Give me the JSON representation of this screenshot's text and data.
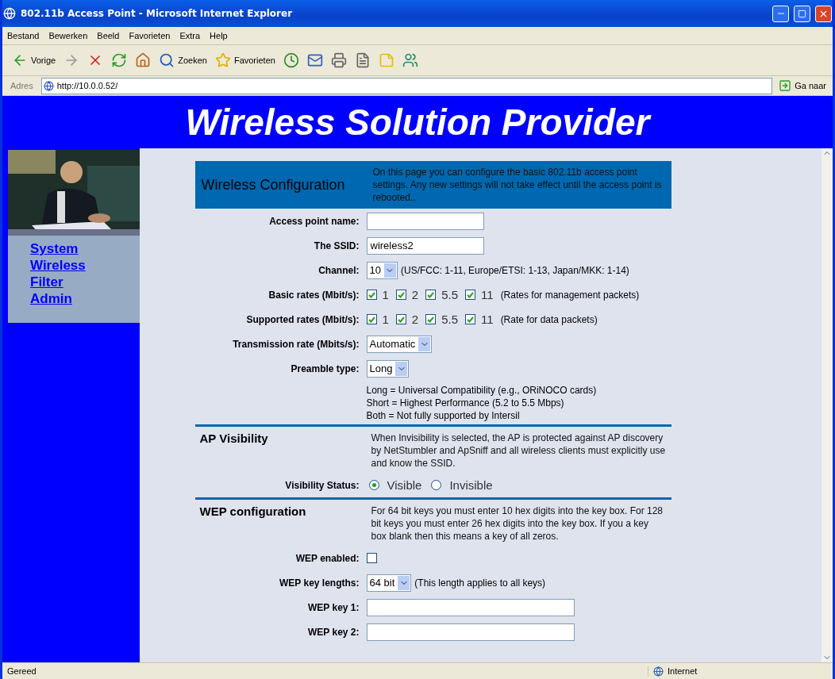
{
  "window": {
    "title": "802.11b Access Point - Microsoft Internet Explorer"
  },
  "menu": [
    "Bestand",
    "Bewerken",
    "Beeld",
    "Favorieten",
    "Extra",
    "Help"
  ],
  "toolbar": {
    "back": "Vorige",
    "search": "Zoeken",
    "favorites": "Favorieten"
  },
  "address": {
    "label": "Adres",
    "url": "http://10.0.0.52/",
    "go": "Ga naar"
  },
  "banner": {
    "title": "Wireless Solution Provider"
  },
  "sidebar": {
    "links": [
      "System",
      "Wireless",
      "Filter",
      "Admin"
    ]
  },
  "sections": [
    {
      "kind": "banner",
      "title": "Wireless Configuration",
      "description": "On this page you can configure the basic 802.11b access point settings. Any new settings will not take effect until the access point is rebooted..",
      "rows": [
        {
          "kind": "text",
          "label": "Access point name:",
          "value": ""
        },
        {
          "kind": "text",
          "label": "The SSID:",
          "value": "wireless2"
        },
        {
          "kind": "select",
          "label": "Channel:",
          "value": "10",
          "note": "(US/FCC: 1-11, Europe/ETSI: 1-13, Japan/MKK: 1-14)"
        },
        {
          "kind": "checks",
          "label": "Basic rates (Mbit/s):",
          "options": [
            {
              "label": "1",
              "checked": true
            },
            {
              "label": "2",
              "checked": true
            },
            {
              "label": "5.5",
              "checked": true
            },
            {
              "label": "11",
              "checked": true
            }
          ],
          "note": "(Rates for management packets)"
        },
        {
          "kind": "checks",
          "label": "Supported rates (Mbit/s):",
          "options": [
            {
              "label": "1",
              "checked": true
            },
            {
              "label": "2",
              "checked": true
            },
            {
              "label": "5.5",
              "checked": true
            },
            {
              "label": "11",
              "checked": true
            }
          ],
          "note": "(Rate for data packets)"
        },
        {
          "kind": "select",
          "label": "Transmission rate (Mbits/s):",
          "value": "Automatic"
        },
        {
          "kind": "select",
          "label": "Preamble type:",
          "value": "Long"
        },
        {
          "kind": "note",
          "lines": [
            "Long = Universal Compatibility (e.g., ORiNOCO cards)",
            "Short = Highest Performance (5.2 to 5.5 Mbps)",
            "Both = Not fully supported by Intersil"
          ]
        }
      ]
    },
    {
      "kind": "plain",
      "title": "AP Visibility",
      "description": "When Invisibility is selected, the AP is protected against AP discovery by NetStumbler and ApSniff and all wireless clients must explicitly use and know the SSID.",
      "rows": [
        {
          "kind": "radio",
          "label": "Visibility Status:",
          "options": [
            {
              "label": "Visible",
              "selected": true
            },
            {
              "label": "Invisible",
              "selected": false
            }
          ]
        }
      ]
    },
    {
      "kind": "plain",
      "title": "WEP configuration",
      "description": "For 64 bit keys you must enter 10 hex digits into the key box. For 128 bit keys you must enter 26 hex digits into the key box. If you a key box blank then this means a key of all zeros.",
      "rows": [
        {
          "kind": "checkbox",
          "label": "WEP enabled:",
          "checked": false
        },
        {
          "kind": "select",
          "label": "WEP key lengths:",
          "value": "64 bit",
          "note": "(This length applies to all keys)"
        },
        {
          "kind": "wide",
          "label": "WEP key 1:",
          "value": ""
        },
        {
          "kind": "wide",
          "label": "WEP key 2:",
          "value": ""
        }
      ]
    }
  ],
  "status_bar": {
    "text": "Gereed",
    "zone": "Internet"
  }
}
